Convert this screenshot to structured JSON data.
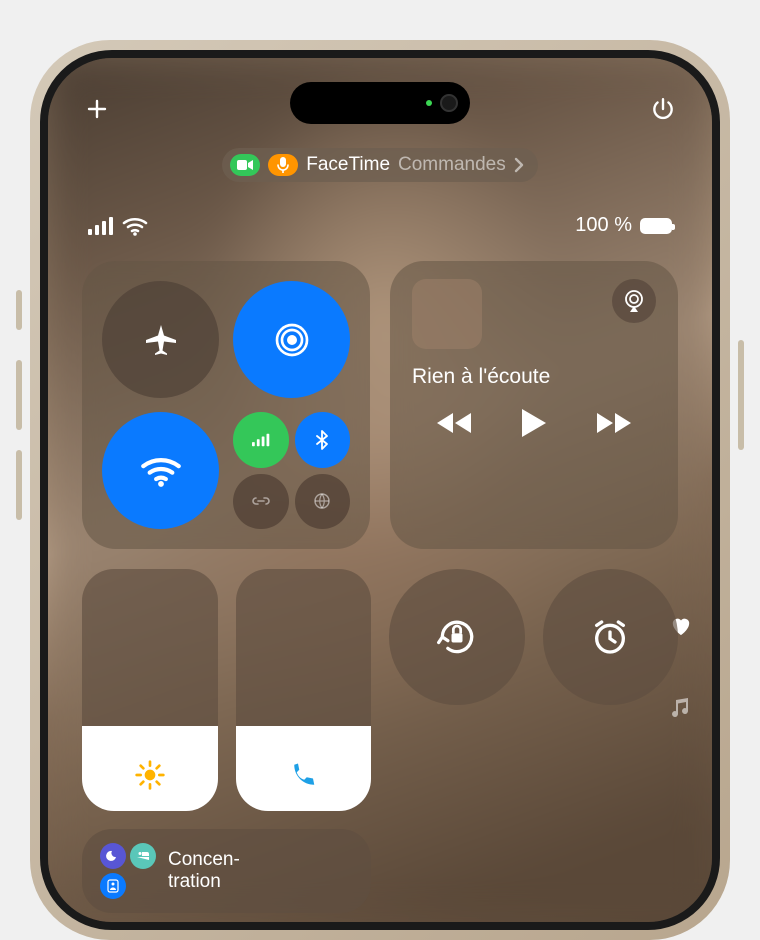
{
  "header": {
    "pill_app": "FaceTime",
    "pill_secondary": "Commandes"
  },
  "status": {
    "battery_text": "100 %"
  },
  "media": {
    "now_playing": "Rien à l'écoute"
  },
  "focus": {
    "label": "Concen-\ntration"
  },
  "sliders": {
    "brightness_pct": 35,
    "volume_pct": 35
  },
  "icons": {
    "add": "plus-icon",
    "power": "power-icon",
    "camera_pill": "video-icon",
    "mic_pill": "mic-icon",
    "cellular": "cellular-icon",
    "wifi_status": "wifi-icon",
    "airplane": "airplane-icon",
    "airdrop": "airdrop-icon",
    "wifi": "wifi-icon",
    "cellular_mini": "cellular-bars-icon",
    "bluetooth": "bluetooth-icon",
    "hotspot": "link-icon",
    "satellite": "globe-icon",
    "airplay": "airplay-icon",
    "rewind": "rewind-icon",
    "play": "play-icon",
    "forward": "forward-icon",
    "orientation_lock": "orientation-lock-icon",
    "alarm": "alarm-icon",
    "brightness": "sun-icon",
    "volume": "phone-icon",
    "heart": "heart-icon",
    "music": "music-icon",
    "moon": "moon-icon",
    "bed": "bed-icon",
    "id": "id-icon"
  },
  "colors": {
    "blue": "#0a7aff",
    "green": "#34c759",
    "orange": "#ff9500"
  }
}
